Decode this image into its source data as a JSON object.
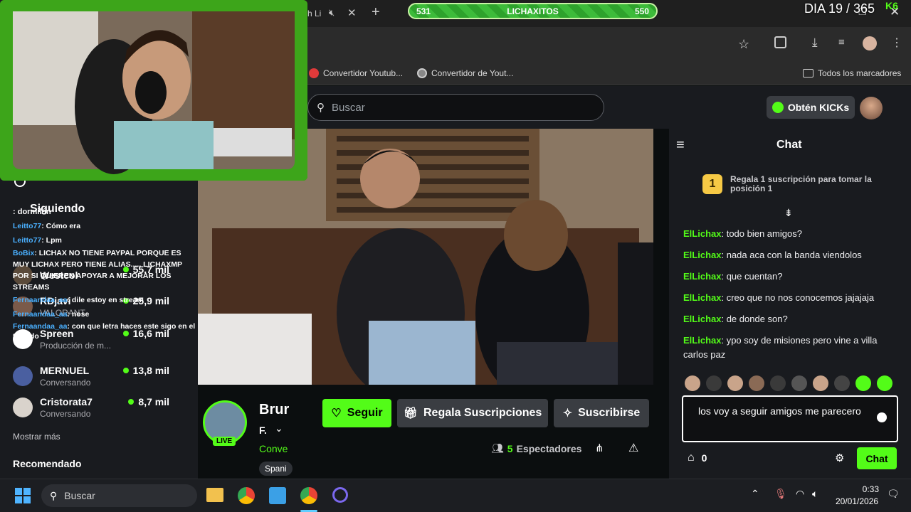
{
  "browser": {
    "tab_partial": "h Li",
    "bookmarks": [
      "Convertidor Youtub...",
      "Convertidor de Yout..."
    ],
    "all_bookmarks": "Todos los marcadores"
  },
  "overlay": {
    "progress_left": "531",
    "progress_title": "LICHAXITOS",
    "progress_right": "550",
    "progress_fraction": 0.5,
    "day_counter": "DIA 19 / 365",
    "brand_mark": "K6"
  },
  "kick": {
    "search_placeholder": "Buscar",
    "kicks_button": "Obtén KICKs",
    "sidebar": {
      "following_title": "Siguiendo",
      "items": [
        {
          "name": "Westcol",
          "sub": "",
          "count": "55,7 mil"
        },
        {
          "name": "RDjavi",
          "sub": "VALORANT",
          "count": "25,9 mil"
        },
        {
          "name": "Spreen",
          "sub": "Producción de m...",
          "count": "16,6 mil"
        },
        {
          "name": "MERNUEL",
          "sub": "Conversando",
          "count": "13,8 mil"
        },
        {
          "name": "Cristorata7",
          "sub": "Conversando",
          "count": "8,7 mil"
        }
      ],
      "show_more": "Mostrar más",
      "recommended": "Recomendado"
    },
    "stream": {
      "streamer_name": "Brur",
      "subtitle": "F.",
      "category": "Conve",
      "tag": "Spani",
      "live_badge": "LIVE",
      "follow_label": "Seguir",
      "gift_label": "Regala Suscripciones",
      "subscribe_label": "Suscribirse",
      "viewers_count": "5",
      "viewers_label": "Espectadores"
    },
    "chat": {
      "title": "Chat",
      "gift_rank": "1",
      "gift_text": "Regala 1 suscripción para tomar la posición 1",
      "messages": [
        {
          "user": "ElLichax",
          "text": "todo bien amigos?"
        },
        {
          "user": "ElLichax",
          "text": "nada aca con la banda viendolos"
        },
        {
          "user": "ElLichax",
          "text": "que cuentan?"
        },
        {
          "user": "ElLichax",
          "text": "creo que no nos conocemos jajajaja"
        },
        {
          "user": "ElLichax",
          "text": "de donde son?"
        },
        {
          "user": "ElLichax",
          "text": "ypo soy de misiones pero vine a villa carlos paz"
        }
      ],
      "input_text": "los voy a seguir amigos me parecero",
      "points": "0",
      "send_label": "Chat"
    }
  },
  "overlay_chat": [
    {
      "user": "",
      "text": ": dormilón"
    },
    {
      "user": "Leitto77",
      "text": ": Cómo era"
    },
    {
      "user": "Leitto77",
      "text": ": Lpm"
    },
    {
      "user": "BoBix",
      "text": ": LICHAX NO TIENE PAYPAL PORQUE ES MUY LICHAX PERO TIENE ALIAS..... LICHAXMP POR SI QUIEREN APOYAR A MEJORAR LOS STREAMS"
    },
    {
      "user": "Fernaandaa_aa",
      "text": ": dile estoy en stream"
    },
    {
      "user": "Fernaandaa_aa",
      "text": ": nose"
    },
    {
      "user": "Fernaandaa_aa",
      "text": ": con que letra haces este sigo en el teclado"
    }
  ],
  "taskbar": {
    "search_placeholder": "Buscar",
    "time": "0:33",
    "date": "20/01/2026"
  }
}
